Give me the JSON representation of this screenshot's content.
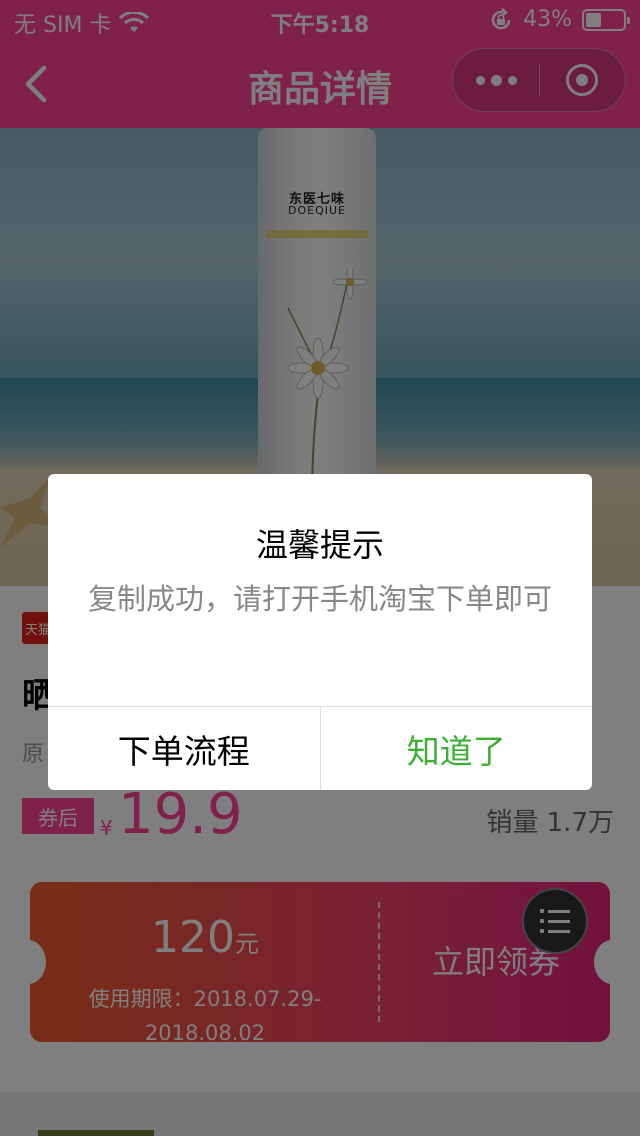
{
  "status_bar": {
    "carrier": "无 SIM 卡",
    "time": "下午5:18",
    "battery_text": "43%",
    "battery_level": 0.43
  },
  "nav": {
    "title": "商品详情",
    "back_icon": "chevron-left-icon",
    "more_icon": "more-dots-icon",
    "close_icon": "target-close-icon"
  },
  "product": {
    "bottle_brand": "东医七味",
    "bottle_brand_en": "DOEQIUE",
    "shop_badge": "天猫",
    "name": "晒",
    "original_price_label": "原",
    "coupon_tag": "券后",
    "currency": "¥",
    "price": "19.9",
    "sales": "销量 1.7万"
  },
  "coupon": {
    "amount": "120",
    "unit": "元",
    "validity_line1": "使用期限：2018.07.29-",
    "validity_line2": "2018.08.02",
    "claim_label": "立即领券"
  },
  "dialog": {
    "title": "温馨提示",
    "message": "复制成功，请打开手机淘宝下单即可",
    "cancel_label": "下单流程",
    "confirm_label": "知道了"
  },
  "colors": {
    "brand_pink": "#fe4394",
    "confirm_green": "#3cb034"
  }
}
